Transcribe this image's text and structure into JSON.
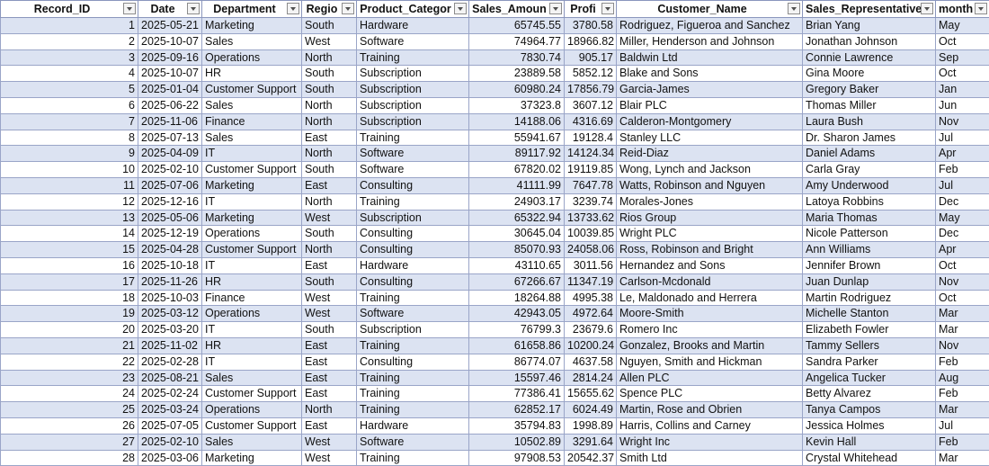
{
  "columns": [
    {
      "key": "Record_ID",
      "label": "Record_ID",
      "align": "num"
    },
    {
      "key": "Date",
      "label": "Date",
      "align": "txt"
    },
    {
      "key": "Department",
      "label": "Department",
      "align": "txt"
    },
    {
      "key": "Region",
      "label": "Regio",
      "align": "txt"
    },
    {
      "key": "Product_Category",
      "label": "Product_Categor",
      "align": "txt"
    },
    {
      "key": "Sales_Amount",
      "label": "Sales_Amoun",
      "align": "num"
    },
    {
      "key": "Profit",
      "label": "Profi",
      "align": "num"
    },
    {
      "key": "Customer_Name",
      "label": "Customer_Name",
      "align": "txt"
    },
    {
      "key": "Sales_Representative",
      "label": "Sales_Representative",
      "align": "txt"
    },
    {
      "key": "month",
      "label": "month",
      "align": "txt"
    }
  ],
  "rows": [
    [
      "1",
      "2025-05-21",
      "Marketing",
      "South",
      "Hardware",
      "65745.55",
      "3780.58",
      "Rodriguez, Figueroa and Sanchez",
      "Brian Yang",
      "May"
    ],
    [
      "2",
      "2025-10-07",
      "Sales",
      "West",
      "Software",
      "74964.77",
      "18966.82",
      "Miller, Henderson and Johnson",
      "Jonathan Johnson",
      "Oct"
    ],
    [
      "3",
      "2025-09-16",
      "Operations",
      "North",
      "Training",
      "7830.74",
      "905.17",
      "Baldwin Ltd",
      "Connie Lawrence",
      "Sep"
    ],
    [
      "4",
      "2025-10-07",
      "HR",
      "South",
      "Subscription",
      "23889.58",
      "5852.12",
      "Blake and Sons",
      "Gina Moore",
      "Oct"
    ],
    [
      "5",
      "2025-01-04",
      "Customer Support",
      "South",
      "Subscription",
      "60980.24",
      "17856.79",
      "Garcia-James",
      "Gregory Baker",
      "Jan"
    ],
    [
      "6",
      "2025-06-22",
      "Sales",
      "North",
      "Subscription",
      "37323.8",
      "3607.12",
      "Blair PLC",
      "Thomas Miller",
      "Jun"
    ],
    [
      "7",
      "2025-11-06",
      "Finance",
      "North",
      "Subscription",
      "14188.06",
      "4316.69",
      "Calderon-Montgomery",
      "Laura Bush",
      "Nov"
    ],
    [
      "8",
      "2025-07-13",
      "Sales",
      "East",
      "Training",
      "55941.67",
      "19128.4",
      "Stanley LLC",
      "Dr. Sharon James",
      "Jul"
    ],
    [
      "9",
      "2025-04-09",
      "IT",
      "North",
      "Software",
      "89117.92",
      "14124.34",
      "Reid-Diaz",
      "Daniel Adams",
      "Apr"
    ],
    [
      "10",
      "2025-02-10",
      "Customer Support",
      "South",
      "Software",
      "67820.02",
      "19119.85",
      "Wong, Lynch and Jackson",
      "Carla Gray",
      "Feb"
    ],
    [
      "11",
      "2025-07-06",
      "Marketing",
      "East",
      "Consulting",
      "41111.99",
      "7647.78",
      "Watts, Robinson and Nguyen",
      "Amy Underwood",
      "Jul"
    ],
    [
      "12",
      "2025-12-16",
      "IT",
      "North",
      "Training",
      "24903.17",
      "3239.74",
      "Morales-Jones",
      "Latoya Robbins",
      "Dec"
    ],
    [
      "13",
      "2025-05-06",
      "Marketing",
      "West",
      "Subscription",
      "65322.94",
      "13733.62",
      "Rios Group",
      "Maria Thomas",
      "May"
    ],
    [
      "14",
      "2025-12-19",
      "Operations",
      "South",
      "Consulting",
      "30645.04",
      "10039.85",
      "Wright PLC",
      "Nicole Patterson",
      "Dec"
    ],
    [
      "15",
      "2025-04-28",
      "Customer Support",
      "North",
      "Consulting",
      "85070.93",
      "24058.06",
      "Ross, Robinson and Bright",
      "Ann Williams",
      "Apr"
    ],
    [
      "16",
      "2025-10-18",
      "IT",
      "East",
      "Hardware",
      "43110.65",
      "3011.56",
      "Hernandez and Sons",
      "Jennifer Brown",
      "Oct"
    ],
    [
      "17",
      "2025-11-26",
      "HR",
      "South",
      "Consulting",
      "67266.67",
      "11347.19",
      "Carlson-Mcdonald",
      "Juan Dunlap",
      "Nov"
    ],
    [
      "18",
      "2025-10-03",
      "Finance",
      "West",
      "Training",
      "18264.88",
      "4995.38",
      "Le, Maldonado and Herrera",
      "Martin Rodriguez",
      "Oct"
    ],
    [
      "19",
      "2025-03-12",
      "Operations",
      "West",
      "Software",
      "42943.05",
      "4972.64",
      "Moore-Smith",
      "Michelle Stanton",
      "Mar"
    ],
    [
      "20",
      "2025-03-20",
      "IT",
      "South",
      "Subscription",
      "76799.3",
      "23679.6",
      "Romero Inc",
      "Elizabeth Fowler",
      "Mar"
    ],
    [
      "21",
      "2025-11-02",
      "HR",
      "East",
      "Training",
      "61658.86",
      "10200.24",
      "Gonzalez, Brooks and Martin",
      "Tammy Sellers",
      "Nov"
    ],
    [
      "22",
      "2025-02-28",
      "IT",
      "East",
      "Consulting",
      "86774.07",
      "4637.58",
      "Nguyen, Smith and Hickman",
      "Sandra Parker",
      "Feb"
    ],
    [
      "23",
      "2025-08-21",
      "Sales",
      "East",
      "Training",
      "15597.46",
      "2814.24",
      "Allen PLC",
      "Angelica Tucker",
      "Aug"
    ],
    [
      "24",
      "2025-02-24",
      "Customer Support",
      "East",
      "Training",
      "77386.41",
      "15655.62",
      "Spence PLC",
      "Betty Alvarez",
      "Feb"
    ],
    [
      "25",
      "2025-03-24",
      "Operations",
      "North",
      "Training",
      "62852.17",
      "6024.49",
      "Martin, Rose and Obrien",
      "Tanya Campos",
      "Mar"
    ],
    [
      "26",
      "2025-07-05",
      "Customer Support",
      "East",
      "Hardware",
      "35794.83",
      "1998.89",
      "Harris, Collins and Carney",
      "Jessica Holmes",
      "Jul"
    ],
    [
      "27",
      "2025-02-10",
      "Sales",
      "West",
      "Software",
      "10502.89",
      "3291.64",
      "Wright Inc",
      "Kevin Hall",
      "Feb"
    ],
    [
      "28",
      "2025-03-06",
      "Marketing",
      "West",
      "Training",
      "97908.53",
      "20542.37",
      "Smith Ltd",
      "Crystal Whitehead",
      "Mar"
    ]
  ]
}
